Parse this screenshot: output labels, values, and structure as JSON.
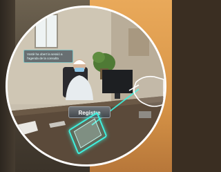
{
  "ar_overlay": {
    "message_text": "Vostè ha obert la sessió a l'agenda de la consulta",
    "register_button_label": "Registre"
  },
  "colors": {
    "lens_border": "#ffffff",
    "hologram": "#3ff2e0",
    "button_bg": "#4f5458"
  },
  "icons": {
    "tablet": "holographic-tablet-icon",
    "hand": "virtual-hand-icon"
  }
}
